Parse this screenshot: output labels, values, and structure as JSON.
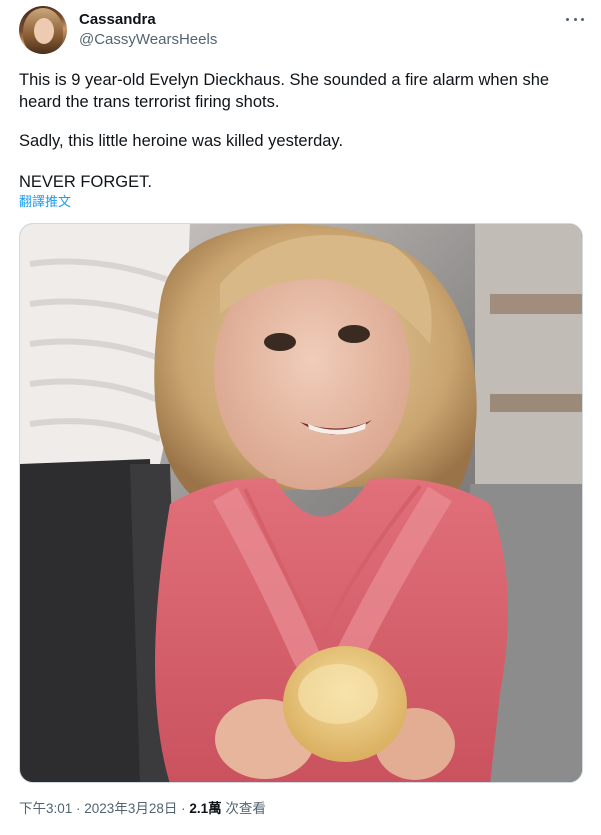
{
  "author": {
    "name": "Cassandra",
    "handle": "@CassyWearsHeels"
  },
  "tweet": {
    "line1": "This is 9 year-old Evelyn Dieckhaus. She sounded a fire alarm when she heard the trans terrorist firing shots.",
    "line2": "Sadly, this little heroine was killed yesterday.",
    "line3": "NEVER FORGET.",
    "translate_link": "翻譯推文"
  },
  "media": {
    "icon": "photo"
  },
  "meta": {
    "time": "下午3:01",
    "sep1": " · ",
    "date": "2023年3月28日",
    "sep2": " · ",
    "views_count": "2.1萬",
    "views_label": " 次查看"
  },
  "icons": {
    "more": "more-horizontal-icon"
  }
}
